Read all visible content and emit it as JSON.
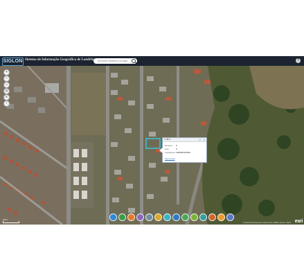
{
  "header": {
    "logo": "SIGLON",
    "title": "Sistema de Informação Geográfica de Londrina",
    "search_placeholder": "Encontre endereço ou lugar",
    "help": "?"
  },
  "map_controls": {
    "zoom_in": "+",
    "zoom_out": "−",
    "home": "⌂",
    "locate": "◎",
    "layers": "≡",
    "back": "‹"
  },
  "popup": {
    "title": "1 de 1",
    "maximize": "□",
    "close": "×",
    "fields": [
      {
        "label": "Número",
        "value": "0"
      },
      {
        "label": "Lote",
        "value": "0"
      },
      {
        "label": "Logradouro",
        "value": "JARDIM ROMA"
      }
    ],
    "zoom_link": "Zoom para",
    "more": "..."
  },
  "toolbar": {
    "buttons": [
      {
        "name": "home-tool",
        "color": "#2d89d3"
      },
      {
        "name": "measure-tool",
        "color": "#3a9b48"
      },
      {
        "name": "layers-tool",
        "color": "#e07a2a"
      },
      {
        "name": "draw-tool",
        "color": "#8b6bb8"
      },
      {
        "name": "edit-tool",
        "color": "#6f8fa0"
      },
      {
        "name": "print-tool",
        "color": "#d9aa2b"
      },
      {
        "name": "share-tool",
        "color": "#3cb3c2"
      },
      {
        "name": "basemap-tool",
        "color": "#2f7bc5"
      },
      {
        "name": "legend-tool",
        "color": "#4aa55a"
      },
      {
        "name": "query-tool",
        "color": "#7bb23a"
      },
      {
        "name": "select-tool",
        "color": "#35a0a0"
      },
      {
        "name": "identify-tool",
        "color": "#d0662e"
      },
      {
        "name": "settings-tool",
        "color": "#ea9b2c"
      },
      {
        "name": "about-tool",
        "color": "#5b78c9"
      }
    ]
  },
  "map": {
    "scale_label": "100 m",
    "attribution": "Prefeitura Municipal de Londrina | Esri, HERE, Garmin, USGS",
    "esri_logo": "esri"
  }
}
